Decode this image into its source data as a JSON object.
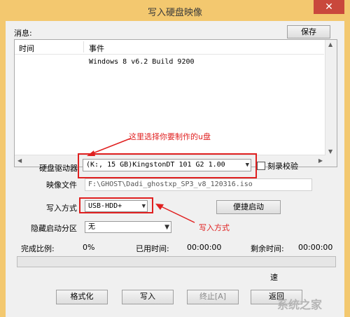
{
  "window": {
    "title": "写入硬盘映像",
    "close": "✕"
  },
  "messages": {
    "label": "消息:",
    "save": "保存",
    "col_time": "时间",
    "col_event": "事件",
    "rows": [
      {
        "time": "",
        "event": "Windows 8 v6.2 Build 9200"
      }
    ]
  },
  "annotation_top": "这里选择你要制作的u盘",
  "annotation_bottom": "写入方式",
  "drive": {
    "label": "硬盘驱动器",
    "value": "(K:, 15 GB)KingstonDT 101 G2      1.00",
    "verify_label": "刻录校验"
  },
  "image": {
    "label": "映像文件",
    "value": "F:\\GHOST\\Dadi_ghostxp_SP3_v8_120316.iso"
  },
  "write_mode": {
    "label": "写入方式",
    "value": "USB-HDD+",
    "quick_boot": "便捷启动"
  },
  "hidden_partition": {
    "label": "隐藏启动分区",
    "value": "无"
  },
  "status": {
    "complete_label": "完成比例:",
    "complete_value": "0%",
    "elapsed_label": "已用时间:",
    "elapsed_value": "00:00:00",
    "remaining_label": "剩余时间:",
    "remaining_value": "00:00:00",
    "progress": 0
  },
  "speed_label": "速",
  "buttons": {
    "format": "格式化",
    "write": "写入",
    "stop": "终止[A]",
    "back": "返回"
  },
  "watermark": "系统之家"
}
